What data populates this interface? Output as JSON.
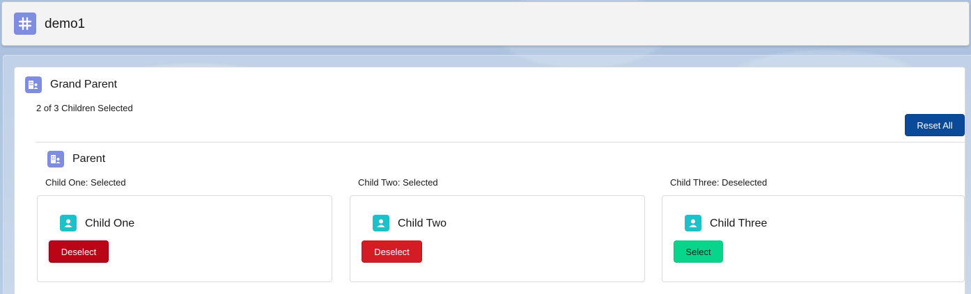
{
  "app": {
    "title": "demo1",
    "icon": "hashtag-icon",
    "icon_color": "#7f8de1"
  },
  "grand_parent": {
    "title": "Grand Parent",
    "icon": "account-building-icon",
    "status": "2 of 3 Children Selected",
    "reset_label": "Reset All",
    "reset_color": "#0b4a98"
  },
  "parent": {
    "title": "Parent",
    "icon": "account-building-icon"
  },
  "children": [
    {
      "status": "Child One: Selected",
      "name": "Child One",
      "icon": "contact-person-icon",
      "button_label": "Deselect",
      "button_color": "#ba0517"
    },
    {
      "status": "Child Two: Selected",
      "name": "Child Two",
      "icon": "contact-person-icon",
      "button_label": "Deselect",
      "button_color": "#d41c26"
    },
    {
      "status": "Child Three: Deselected",
      "name": "Child Three",
      "icon": "contact-person-icon",
      "button_label": "Select",
      "button_color": "#08d48c"
    }
  ]
}
